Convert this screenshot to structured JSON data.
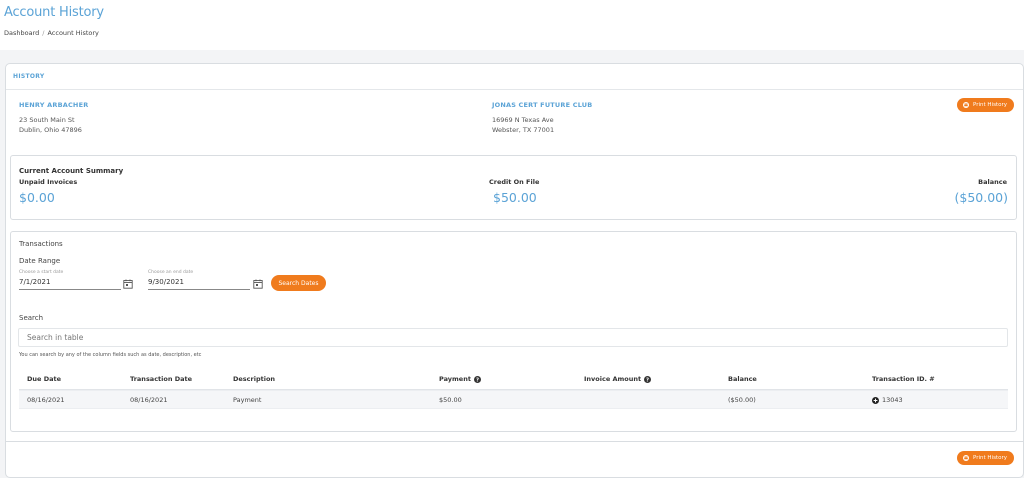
{
  "page": {
    "title": "Account History"
  },
  "breadcrumb": {
    "items": [
      "Dashboard",
      "Account History"
    ],
    "separator": "/"
  },
  "panel": {
    "header": "HISTORY"
  },
  "customer": {
    "name": "HENRY ARBACHER",
    "address_line1": "23 South Main St",
    "address_line2": "Dublin, Ohio 47896"
  },
  "club": {
    "name": "JONAS CERT FUTURE CLUB",
    "address_line1": "16969 N Texas Ave",
    "address_line2": "Webster, TX 77001"
  },
  "buttons": {
    "print_history": "Print History",
    "search_dates": "Search Dates"
  },
  "summary": {
    "title": "Current Account Summary",
    "unpaid_label": "Unpaid Invoices",
    "unpaid_value": "$0.00",
    "credit_label": "Credit On File",
    "credit_value": "$50.00",
    "balance_label": "Balance",
    "balance_value": "($50.00)"
  },
  "transactions": {
    "title": "Transactions",
    "date_range_label": "Date Range",
    "start_hint": "Choose a start date",
    "start_value": "7/1/2021",
    "end_hint": "Choose an end date",
    "end_value": "9/30/2021",
    "search_label": "Search",
    "search_placeholder": "Search in table",
    "search_help": "You can search by any of the column fields such as date, description, etc",
    "columns": {
      "due_date": "Due Date",
      "transaction_date": "Transaction Date",
      "description": "Description",
      "payment": "Payment",
      "invoice_amount": "Invoice Amount",
      "balance": "Balance",
      "transaction_id": "Transaction ID. #"
    },
    "rows": [
      {
        "due_date": "08/16/2021",
        "transaction_date": "08/16/2021",
        "description": "Payment",
        "payment": "$50.00",
        "invoice_amount": "",
        "balance": "($50.00)",
        "transaction_id": "13043"
      }
    ]
  },
  "colors": {
    "accent": "#5ba3d6",
    "button": "#f07b1d"
  },
  "icons": {
    "print": "print-icon",
    "calendar": "calendar-icon",
    "help": "question-circle-icon",
    "expand": "plus-circle-icon"
  }
}
